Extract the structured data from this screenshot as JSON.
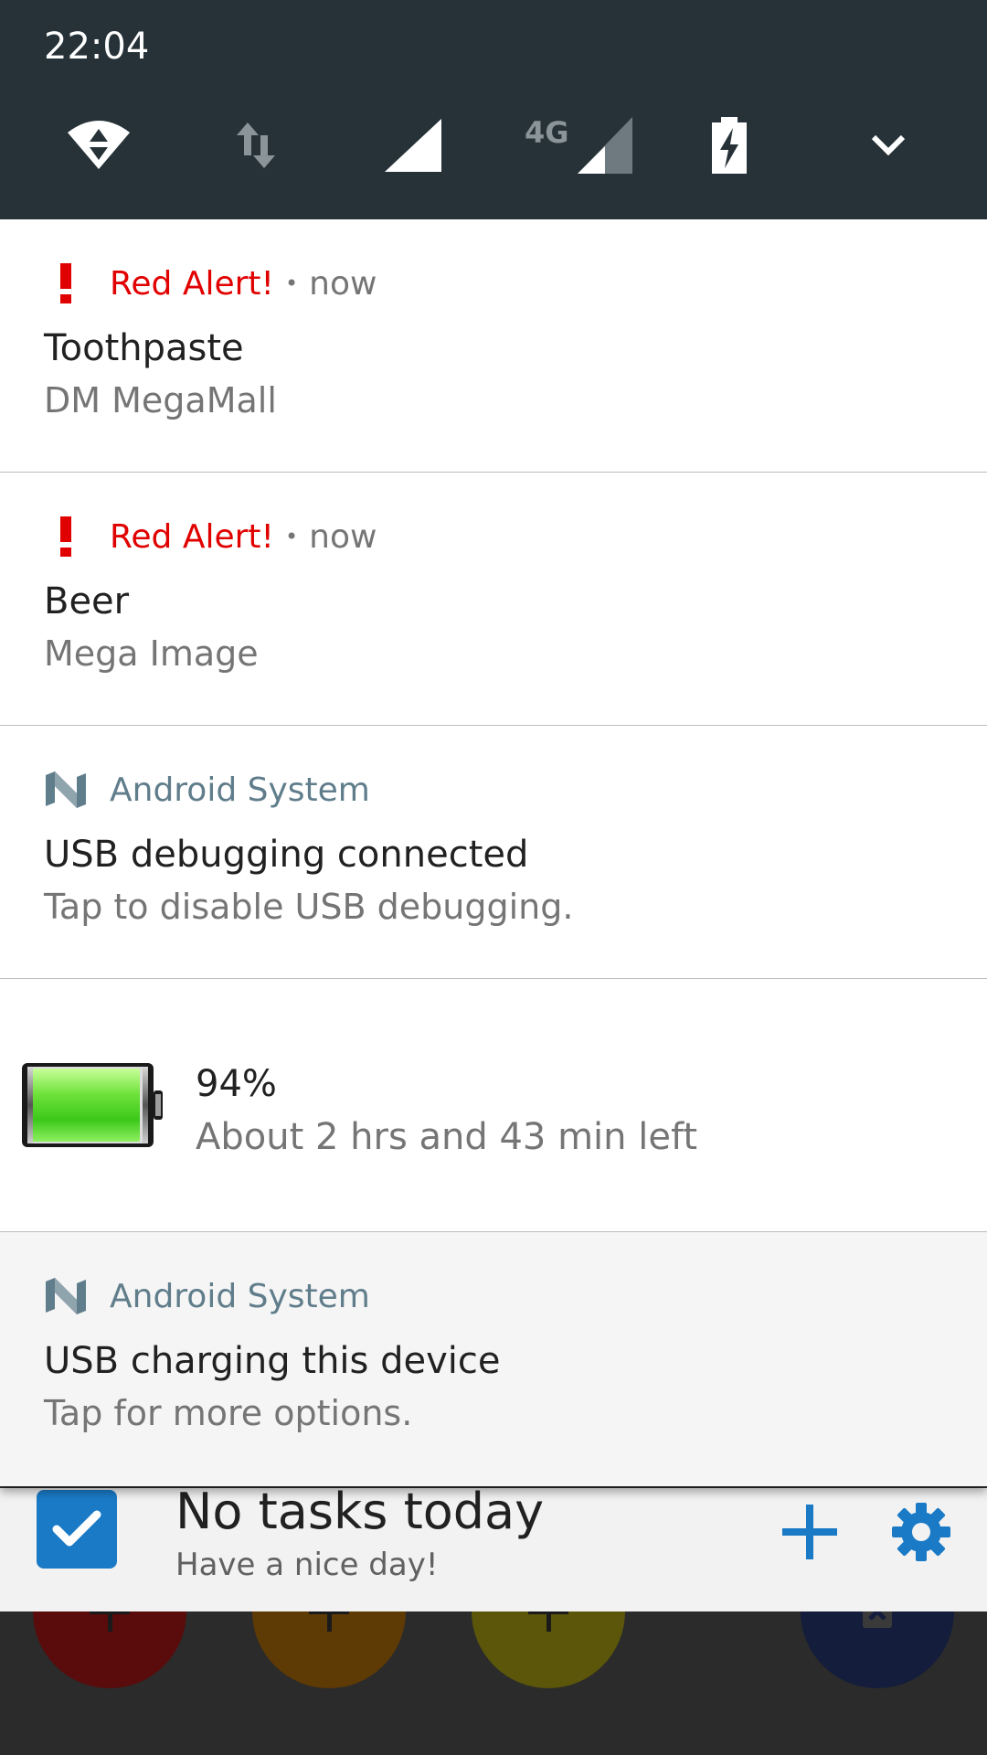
{
  "status_bar": {
    "time": "22:04",
    "icons": [
      "wifi-icon",
      "data-transfer-icon",
      "signal-icon",
      "lte-signal-icon",
      "battery-charging-icon",
      "expand-chevron-icon"
    ],
    "network_type": "4G"
  },
  "notifications": [
    {
      "app": "Red Alert!",
      "time": "now",
      "title": "Toothpaste",
      "text": "DM MegaMall",
      "icon": "exclamation-icon",
      "app_color": "#e10000"
    },
    {
      "app": "Red Alert!",
      "time": "now",
      "title": "Beer",
      "text": "Mega Image",
      "icon": "exclamation-icon",
      "app_color": "#e10000"
    },
    {
      "app": "Android System",
      "title": "USB debugging connected",
      "text": "Tap to disable USB debugging.",
      "icon": "android-n-icon",
      "app_color": "#607d8b"
    },
    {
      "type": "battery",
      "percent": "94%",
      "remaining": "About 2 hrs and 43 min left",
      "level": 0.94,
      "icon": "battery-level-icon"
    },
    {
      "app": "Android System",
      "title": "USB charging this device",
      "text": "Tap for more options.",
      "icon": "android-n-icon",
      "app_color": "#607d8b"
    }
  ],
  "widget": {
    "title": "No tasks today",
    "subtitle": "Have a nice day!",
    "accent": "#1a7ac6",
    "icons": [
      "checkbox-icon",
      "add-icon",
      "settings-gear-icon"
    ]
  },
  "home_screen": {
    "fab_colors": [
      "#5a0b0b",
      "#5e3a05",
      "#5b560a",
      "#141d3b"
    ]
  }
}
